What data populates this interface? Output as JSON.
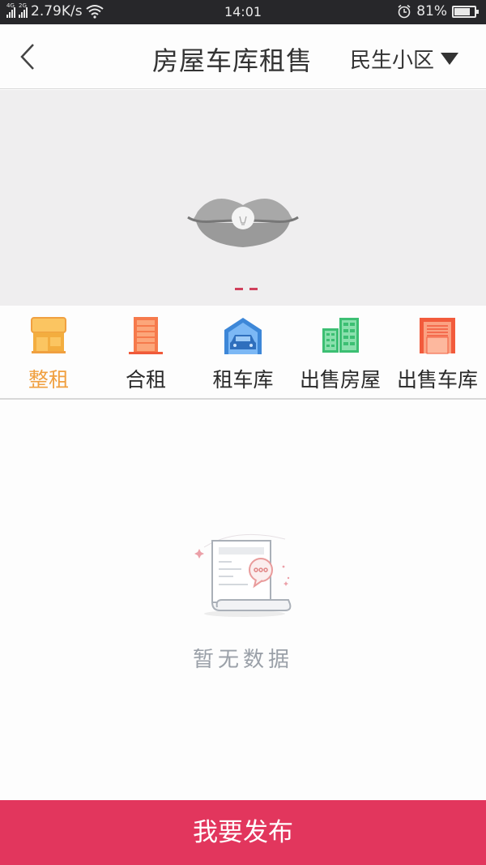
{
  "status_bar": {
    "network_1": "4G",
    "network_2": "2G",
    "speed": "2.79K/s",
    "time": "14:01",
    "battery": "81%",
    "battery_level": 0.81,
    "icons": [
      "signal-icon",
      "signal-icon",
      "wifi-icon",
      "alarm-icon",
      "battery-icon"
    ]
  },
  "header": {
    "back_icon": "chevron-left-icon",
    "title": "房屋车库租售",
    "community": "民生小区",
    "dropdown_icon": "triangle-down-icon"
  },
  "banner": {
    "image": "lips-lightbulb-placeholder",
    "page_count": 2,
    "indicator_color": "#d0405c"
  },
  "nav": {
    "items": [
      {
        "label": "整租",
        "icon": "shop-icon",
        "active": true
      },
      {
        "label": "合租",
        "icon": "building-icon",
        "active": false
      },
      {
        "label": "租车库",
        "icon": "garage-car-icon",
        "active": false
      },
      {
        "label": "出售房屋",
        "icon": "office-buildings-icon",
        "active": false
      },
      {
        "label": "出售车库",
        "icon": "garage-door-icon",
        "active": false
      }
    ],
    "active_color": "#f0a040"
  },
  "empty_state": {
    "icon": "empty-document-icon",
    "text": "暂无数据"
  },
  "footer": {
    "publish_label": "我要发布",
    "color": "#e2365d"
  }
}
